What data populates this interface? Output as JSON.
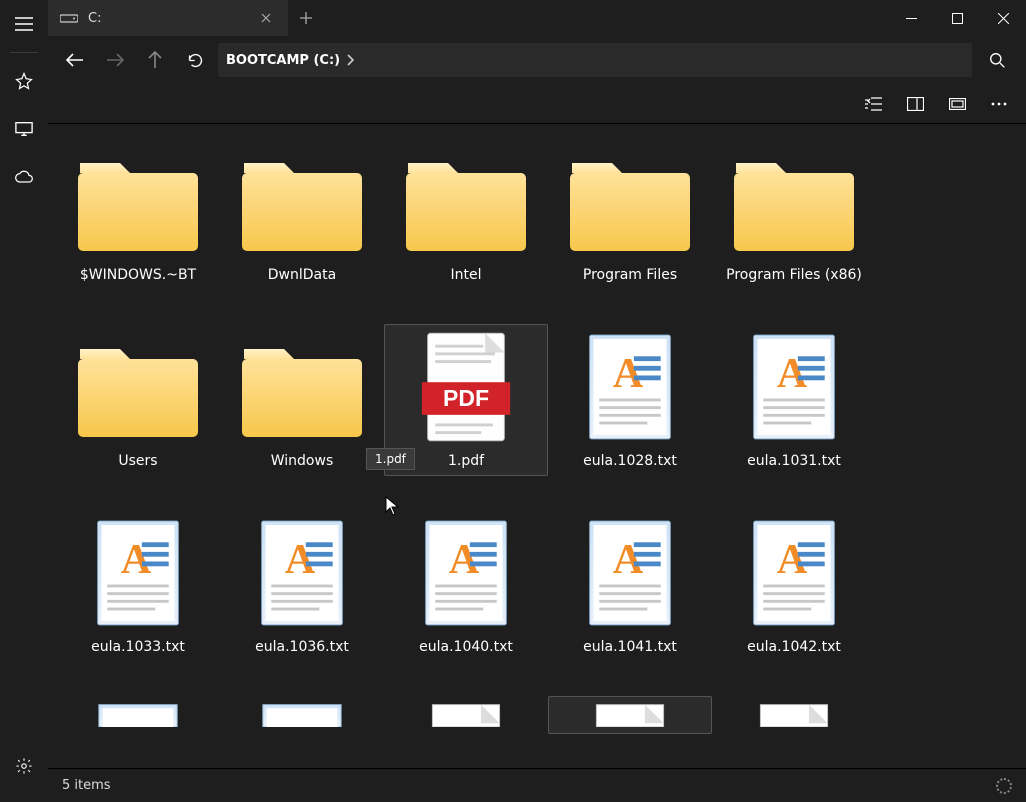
{
  "rail": {
    "menu": "menu-icon",
    "favorite": "star-outline-icon",
    "desktop": "desktop-icon",
    "cloud": "cloud-icon",
    "settings": "gear-icon"
  },
  "tab": {
    "title": "C:",
    "close": "×",
    "newtab": "+"
  },
  "titlebar": {
    "min": "minimize",
    "max": "maximize",
    "close": "close"
  },
  "nav": {
    "back": "back",
    "forward": "forward",
    "up": "up",
    "refresh": "refresh",
    "search": "search"
  },
  "breadcrumb": {
    "segments": [
      "BOOTCAMP (C:)"
    ]
  },
  "toolbar": {
    "details_view": "details-view",
    "preview": "preview-pane",
    "layout": "layout",
    "more": "more"
  },
  "tooltip": {
    "text": "1.pdf"
  },
  "items": [
    {
      "name": "$WINDOWS.~BT",
      "type": "folder"
    },
    {
      "name": "DwnlData",
      "type": "folder"
    },
    {
      "name": "Intel",
      "type": "folder"
    },
    {
      "name": "Program Files",
      "type": "folder"
    },
    {
      "name": "Program Files (x86)",
      "type": "folder"
    },
    {
      "name": "Users",
      "type": "folder"
    },
    {
      "name": "Windows",
      "type": "folder"
    },
    {
      "name": "1.pdf",
      "type": "pdf",
      "selected": true
    },
    {
      "name": "eula.1028.txt",
      "type": "txt"
    },
    {
      "name": "eula.1031.txt",
      "type": "txt"
    },
    {
      "name": "eula.1033.txt",
      "type": "txt"
    },
    {
      "name": "eula.1036.txt",
      "type": "txt"
    },
    {
      "name": "eula.1040.txt",
      "type": "txt"
    },
    {
      "name": "eula.1041.txt",
      "type": "txt"
    },
    {
      "name": "eula.1042.txt",
      "type": "txt"
    },
    {
      "name": "",
      "type": "file-partial"
    },
    {
      "name": "",
      "type": "file-partial"
    },
    {
      "name": "",
      "type": "file-generic-partial"
    },
    {
      "name": "",
      "type": "file-generic-partial",
      "selected": true
    },
    {
      "name": "",
      "type": "file-generic-partial"
    }
  ],
  "status": {
    "text": "5 items"
  }
}
